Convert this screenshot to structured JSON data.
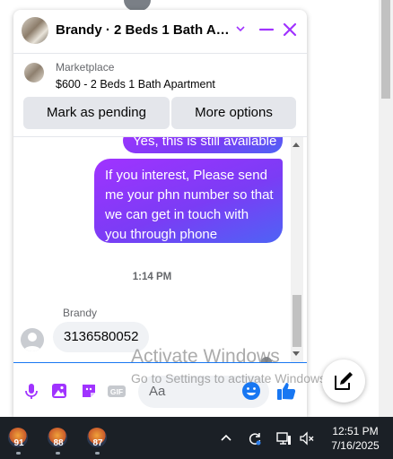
{
  "chat": {
    "title": "Brandy · 2 Beds 1 Bath Apa...",
    "marketplace": {
      "label": "Marketplace",
      "listing": "$600 - 2 Beds 1 Bath Apartment",
      "mark_pending_label": "Mark as pending",
      "more_options_label": "More options"
    },
    "messages": {
      "previous_outgoing": "Yes, this is still available",
      "outgoing": "If you interest, Please send me your phn number so that we can get in touch with you through phone",
      "time_separator": "1:14 PM",
      "sender_name": "Brandy",
      "incoming": "3136580052"
    },
    "composer": {
      "placeholder": "Aa"
    },
    "accent_color": "#a033ff"
  },
  "watermark": {
    "title": "Activate Windows",
    "subtitle": "Go to Settings to activate Windows."
  },
  "taskbar": {
    "apps": [
      {
        "badge": "91",
        "icon": "game-icon"
      },
      {
        "badge": "88",
        "icon": "game-icon"
      },
      {
        "badge": "87",
        "icon": "game-icon"
      }
    ],
    "clock": {
      "time": "12:51 PM",
      "date": "7/16/2025"
    }
  }
}
